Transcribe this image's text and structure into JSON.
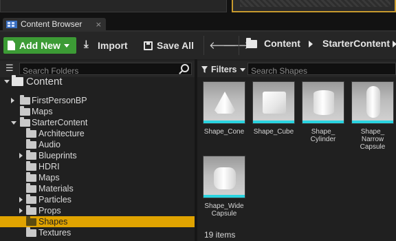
{
  "tab": {
    "label": "Content Browser",
    "close": "×",
    "icon": "content-browser-icon"
  },
  "toolbar": {
    "add_new": "Add New",
    "import": "Import",
    "save_all": "Save All",
    "back": "🡐",
    "forward": "🡒"
  },
  "breadcrumb": [
    "Content",
    "StarterContent"
  ],
  "folders": {
    "search_placeholder": "Search Folders",
    "tree": [
      {
        "label": "Content",
        "level": 0,
        "expander": "open",
        "selected": false
      },
      {
        "label": "FirstPersonBP",
        "level": 1,
        "expander": "closed",
        "selected": false
      },
      {
        "label": "Maps",
        "level": 1,
        "expander": "none",
        "selected": false
      },
      {
        "label": "StarterContent",
        "level": 1,
        "expander": "open",
        "selected": false
      },
      {
        "label": "Architecture",
        "level": 2,
        "expander": "none",
        "selected": false
      },
      {
        "label": "Audio",
        "level": 2,
        "expander": "none",
        "selected": false
      },
      {
        "label": "Blueprints",
        "level": 2,
        "expander": "closed",
        "selected": false
      },
      {
        "label": "HDRI",
        "level": 2,
        "expander": "none",
        "selected": false
      },
      {
        "label": "Maps",
        "level": 2,
        "expander": "none",
        "selected": false
      },
      {
        "label": "Materials",
        "level": 2,
        "expander": "none",
        "selected": false
      },
      {
        "label": "Particles",
        "level": 2,
        "expander": "closed",
        "selected": false
      },
      {
        "label": "Props",
        "level": 2,
        "expander": "closed",
        "selected": false
      },
      {
        "label": "Shapes",
        "level": 2,
        "expander": "none",
        "selected": true
      },
      {
        "label": "Textures",
        "level": 2,
        "expander": "none",
        "selected": false
      }
    ]
  },
  "assets": {
    "filters_label": "Filters",
    "search_placeholder": "Search Shapes",
    "items": [
      {
        "label": "Shape_Cone",
        "shape": "cone"
      },
      {
        "label": "Shape_Cube",
        "shape": "cube"
      },
      {
        "label": "Shape_\nCylinder",
        "shape": "cylinder"
      },
      {
        "label": "Shape_\nNarrow\nCapsule",
        "shape": "capsule"
      },
      {
        "label": "Shape_Wide\nCapsule",
        "shape": "wide-capsule"
      }
    ],
    "count": "19 items"
  },
  "colors": {
    "add_new_green": "#3c9b35",
    "selection_orange": "#e0a300",
    "thumb_bar_cyan": "#2ad4e0"
  }
}
